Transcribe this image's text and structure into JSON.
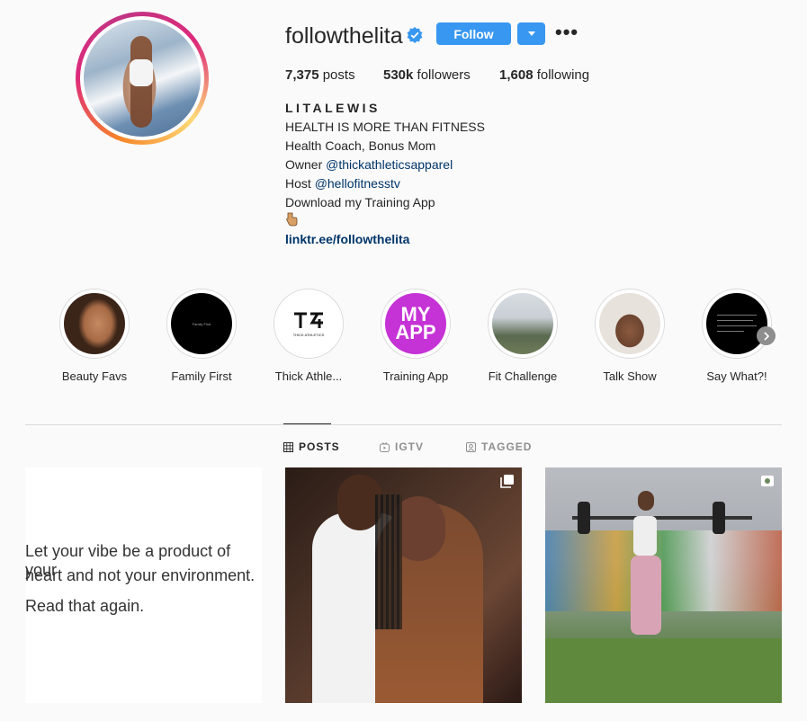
{
  "profile": {
    "username": "followthelita",
    "follow_label": "Follow",
    "stats": {
      "posts_count": "7,375",
      "posts_label": "posts",
      "followers_count": "530k",
      "followers_label": "followers",
      "following_count": "1,608",
      "following_label": "following"
    },
    "full_name": "LITALEWIS",
    "bio": {
      "line1": "HEALTH IS MORE THAN FITNESS",
      "line2": "Health Coach, Bonus Mom",
      "line3_prefix": "Owner ",
      "line3_link": "@thickathleticsapparel",
      "line4_prefix": "Host ",
      "line4_link": "@hellofitnesstv",
      "line5": "Download my Training App"
    },
    "website": "linktr.ee/followthelita"
  },
  "highlights": [
    {
      "label": "Beauty Favs"
    },
    {
      "label": "Family First",
      "inner_text": "Family First"
    },
    {
      "label": "Thick Athle...",
      "inner_text": "THICK ATHLETICS"
    },
    {
      "label": "Training App",
      "inner_text_1": "MY",
      "inner_text_2": "APP"
    },
    {
      "label": "Fit Challenge"
    },
    {
      "label": "Talk Show"
    },
    {
      "label": "Say What?!"
    }
  ],
  "tabs": {
    "posts": "POSTS",
    "igtv": "IGTV",
    "tagged": "TAGGED"
  },
  "posts": [
    {
      "quote_line1": "Let your vibe be a product of your",
      "quote_line2": "heart and not your environment.",
      "quote_line3": "Read that again."
    },
    {
      "type": "multi-photo"
    },
    {
      "type": "video"
    }
  ],
  "colors": {
    "follow_blue": "#3897f0",
    "link_blue": "#003569",
    "training_app_purple": "#c532d6"
  }
}
